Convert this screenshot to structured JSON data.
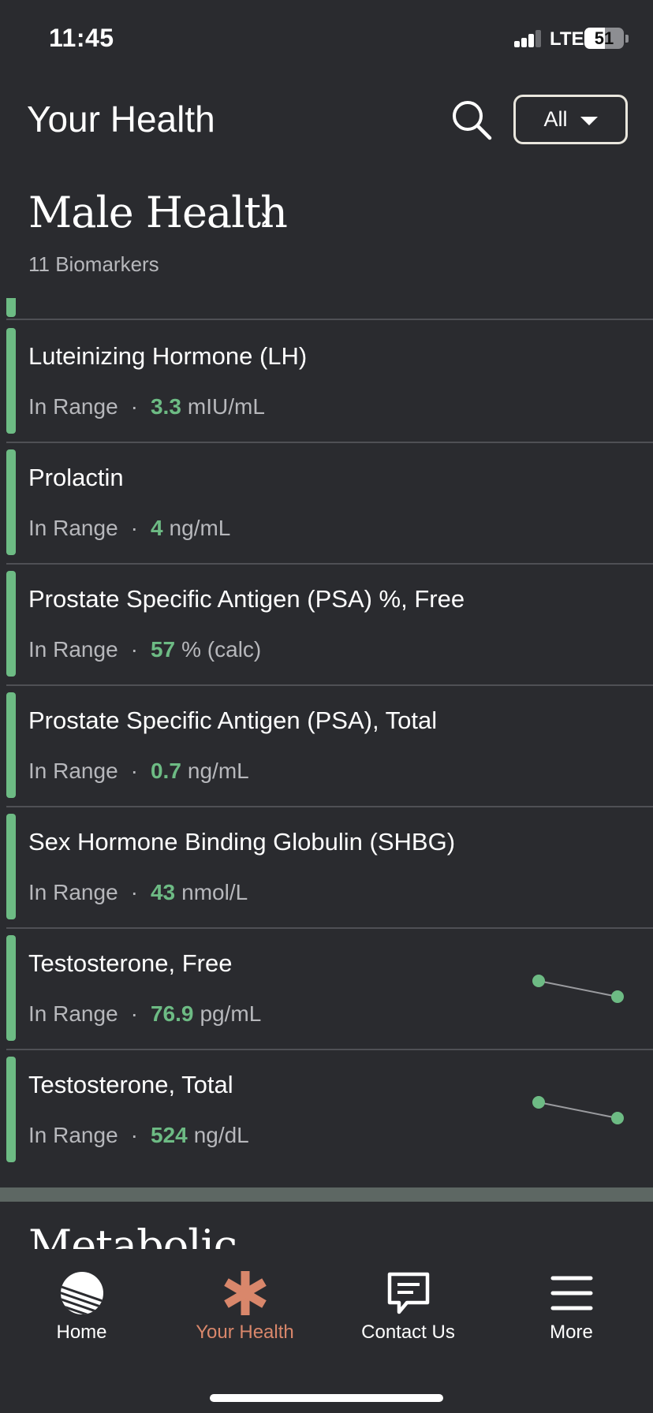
{
  "status_bar": {
    "time": "11:45",
    "network": "LTE",
    "battery": "51",
    "battery_level": 0.51
  },
  "header": {
    "title": "Your Health",
    "filter_label": "All"
  },
  "section": {
    "title": "Male Health",
    "subtitle": "11 Biomarkers"
  },
  "biomarkers": [
    {
      "name": "Luteinizing Hormone (LH)",
      "status": "In Range",
      "value": "3.3",
      "unit": "mIU/mL",
      "has_trend": false
    },
    {
      "name": "Prolactin",
      "status": "In Range",
      "value": "4",
      "unit": "ng/mL",
      "has_trend": false
    },
    {
      "name": "Prostate Specific Antigen (PSA) %, Free",
      "status": "In Range",
      "value": "57",
      "unit": "% (calc)",
      "has_trend": false
    },
    {
      "name": "Prostate Specific Antigen (PSA), Total",
      "status": "In Range",
      "value": "0.7",
      "unit": "ng/mL",
      "has_trend": false
    },
    {
      "name": "Sex Hormone Binding Globulin (SHBG)",
      "status": "In Range",
      "value": "43",
      "unit": "nmol/L",
      "has_trend": false
    },
    {
      "name": "Testosterone, Free",
      "status": "In Range",
      "value": "76.9",
      "unit": "pg/mL",
      "has_trend": true
    },
    {
      "name": "Testosterone, Total",
      "status": "In Range",
      "value": "524",
      "unit": "ng/dL",
      "has_trend": true
    }
  ],
  "next_section": {
    "title": "Metabolic"
  },
  "tabs": [
    {
      "label": "Home",
      "icon": "home-globe-icon",
      "active": false
    },
    {
      "label": "Your Health",
      "icon": "asterisk-icon",
      "active": true
    },
    {
      "label": "Contact Us",
      "icon": "chat-bubble-icon",
      "active": false
    },
    {
      "label": "More",
      "icon": "menu-icon",
      "active": false
    }
  ],
  "colors": {
    "background": "#2a2b2f",
    "in_range": "#6dbb84",
    "active_tab": "#d9876b",
    "divider": "#4f5055"
  }
}
